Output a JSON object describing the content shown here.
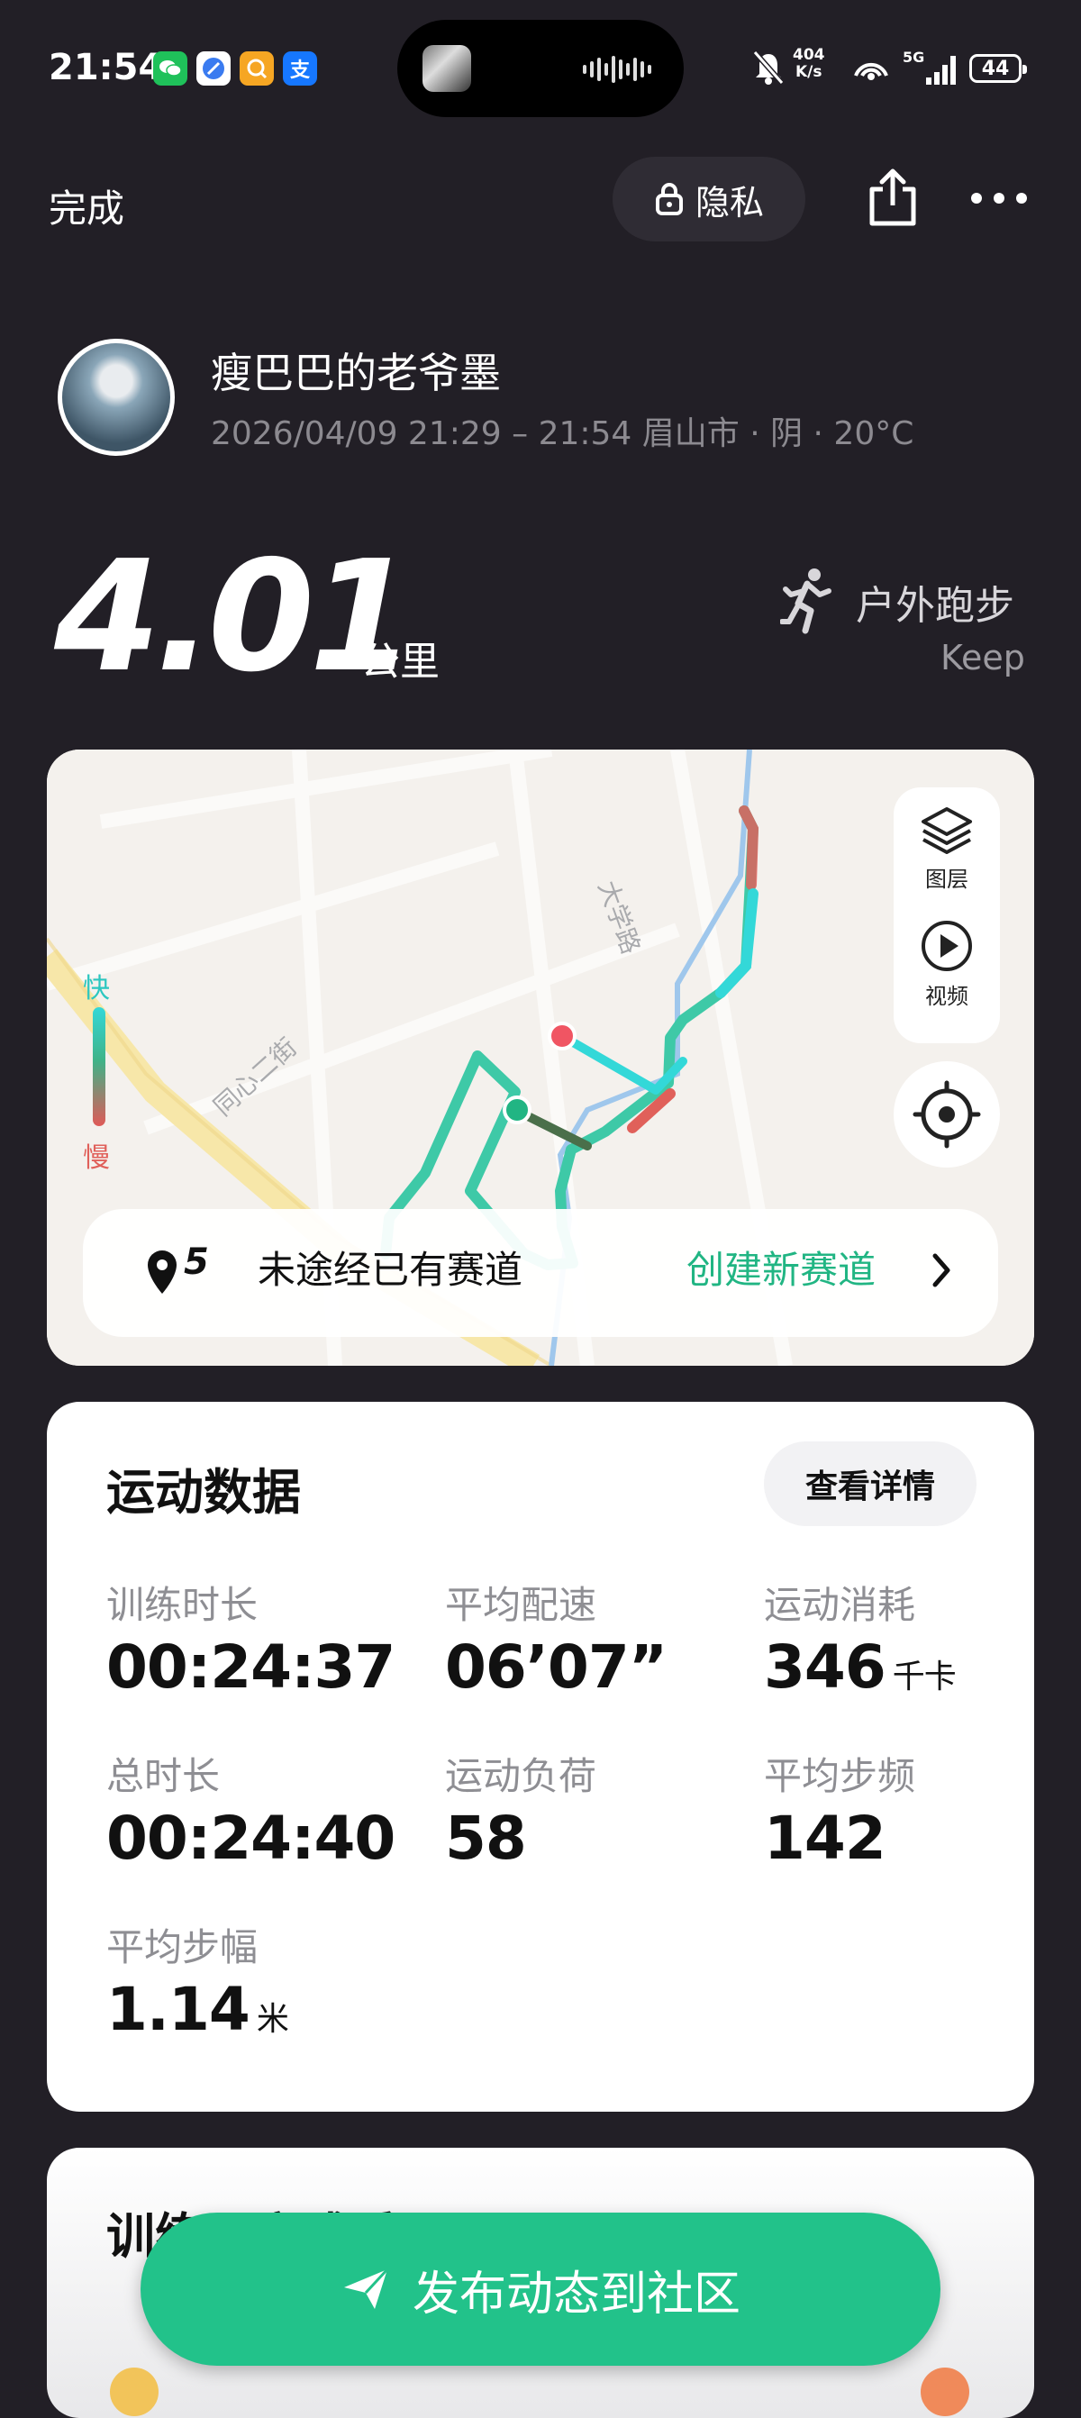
{
  "status_bar": {
    "time": "21:54",
    "network_speed_value": "404",
    "network_speed_unit": "K/s",
    "signal_label": "5G",
    "battery": "44",
    "apps": [
      "wechat-icon",
      "browser-icon",
      "qq-icon",
      "alipay-icon"
    ],
    "alipay_glyph": "支"
  },
  "nav": {
    "done_label": "完成",
    "privacy_label": "隐私"
  },
  "profile": {
    "username": "瘦巴巴的老爷墨",
    "meta": "2026/04/09 21:29 – 21:54 眉山市 · 阴 · 20°C"
  },
  "summary": {
    "distance": "4.01",
    "distance_unit": "公里",
    "sport_type": "户外跑步",
    "source": "Keep"
  },
  "map": {
    "layers_label": "图层",
    "video_label": "视频",
    "legend_fast": "快",
    "legend_slow": "慢",
    "street_1": "大学路",
    "street_2": "同心二街",
    "route_count": "5",
    "route_status": "未途经已有赛道",
    "create_route_label": "创建新赛道"
  },
  "stats": {
    "title": "运动数据",
    "detail_button": "查看详情",
    "items": [
      {
        "label": "训练时长",
        "value": "00:24:37",
        "unit": ""
      },
      {
        "label": "平均配速",
        "value": "06’07”",
        "unit": ""
      },
      {
        "label": "运动消耗",
        "value": "346",
        "unit": "千卡"
      },
      {
        "label": "总时长",
        "value": "00:24:40",
        "unit": ""
      },
      {
        "label": "运动负荷",
        "value": "58",
        "unit": ""
      },
      {
        "label": "平均步频",
        "value": "142",
        "unit": ""
      },
      {
        "label": "平均步幅",
        "value": "1.14",
        "unit": "米"
      }
    ]
  },
  "feeling": {
    "title": "训练强度感受"
  },
  "publish_button": "发布动态到社区",
  "colors": {
    "background": "#221f26",
    "accent_green": "#22c28a",
    "route_fast": "#33d8d8",
    "route_slow": "#e05a58"
  }
}
